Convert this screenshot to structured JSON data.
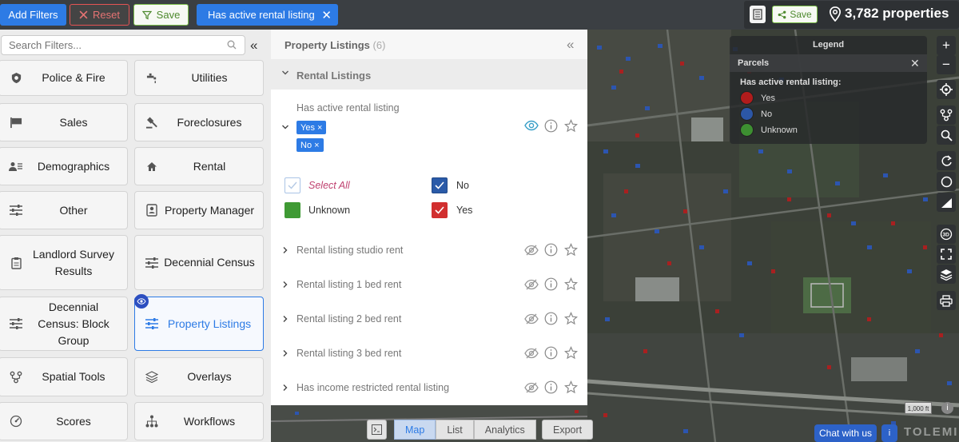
{
  "toolbar": {
    "add_filters": "Add Filters",
    "reset": "Reset",
    "save": "Save",
    "active_chip": "Has active rental listing",
    "save_right": "Save",
    "property_count": "3,782 properties"
  },
  "sidebar": {
    "search_placeholder": "Search Filters...",
    "categories": [
      {
        "label": "Police & Fire",
        "icon": "badge-icon"
      },
      {
        "label": "Utilities",
        "icon": "faucet-icon"
      },
      {
        "label": "Sales",
        "icon": "flag-icon"
      },
      {
        "label": "Foreclosures",
        "icon": "gavel-icon"
      },
      {
        "label": "Demographics",
        "icon": "people-icon"
      },
      {
        "label": "Rental",
        "icon": "home-icon"
      },
      {
        "label": "Other",
        "icon": "sliders-icon"
      },
      {
        "label": "Property Manager",
        "icon": "id-card-icon"
      },
      {
        "label": "Landlord Survey Results",
        "icon": "clipboard-icon"
      },
      {
        "label": "Decennial Census",
        "icon": "sliders-icon"
      },
      {
        "label": "Decennial Census: Block Group",
        "icon": "sliders-icon"
      },
      {
        "label": "Property Listings",
        "icon": "sliders-icon",
        "active": true
      },
      {
        "label": "Spatial Tools",
        "icon": "spatial-icon"
      },
      {
        "label": "Overlays",
        "icon": "layers-icon"
      },
      {
        "label": "Scores",
        "icon": "gauge-icon"
      },
      {
        "label": "Workflows",
        "icon": "workflow-icon"
      }
    ]
  },
  "panel": {
    "title": "Property Listings",
    "count": "(6)",
    "section": "Rental Listings",
    "filter_label": "Has active rental listing",
    "tags": [
      "Yes ×",
      "No ×"
    ],
    "options": {
      "select_all": "Select All",
      "no": "No",
      "unknown": "Unknown",
      "yes": "Yes"
    },
    "rows": [
      "Rental listing studio rent",
      "Rental listing 1 bed rent",
      "Rental listing 2 bed rent",
      "Rental listing 3 bed rent",
      "Has income restricted rental listing"
    ]
  },
  "legend": {
    "title": "Legend",
    "layer": "Parcels",
    "caption": "Has active rental listing:",
    "items": [
      {
        "label": "Yes",
        "color": "#b01c1c"
      },
      {
        "label": "No",
        "color": "#2c57a6"
      },
      {
        "label": "Unknown",
        "color": "#3d8f31"
      }
    ]
  },
  "view_tabs": [
    "Map",
    "List",
    "Analytics"
  ],
  "export": "Export",
  "scale": "1,000 ft",
  "chat": "Chat with us",
  "chat_info": "i",
  "brand": "TOLEMI",
  "colors": {
    "accent": "#2d7be5",
    "yes": "#d12f2f",
    "no": "#2a5aa8",
    "unknown": "#3f9a34"
  }
}
